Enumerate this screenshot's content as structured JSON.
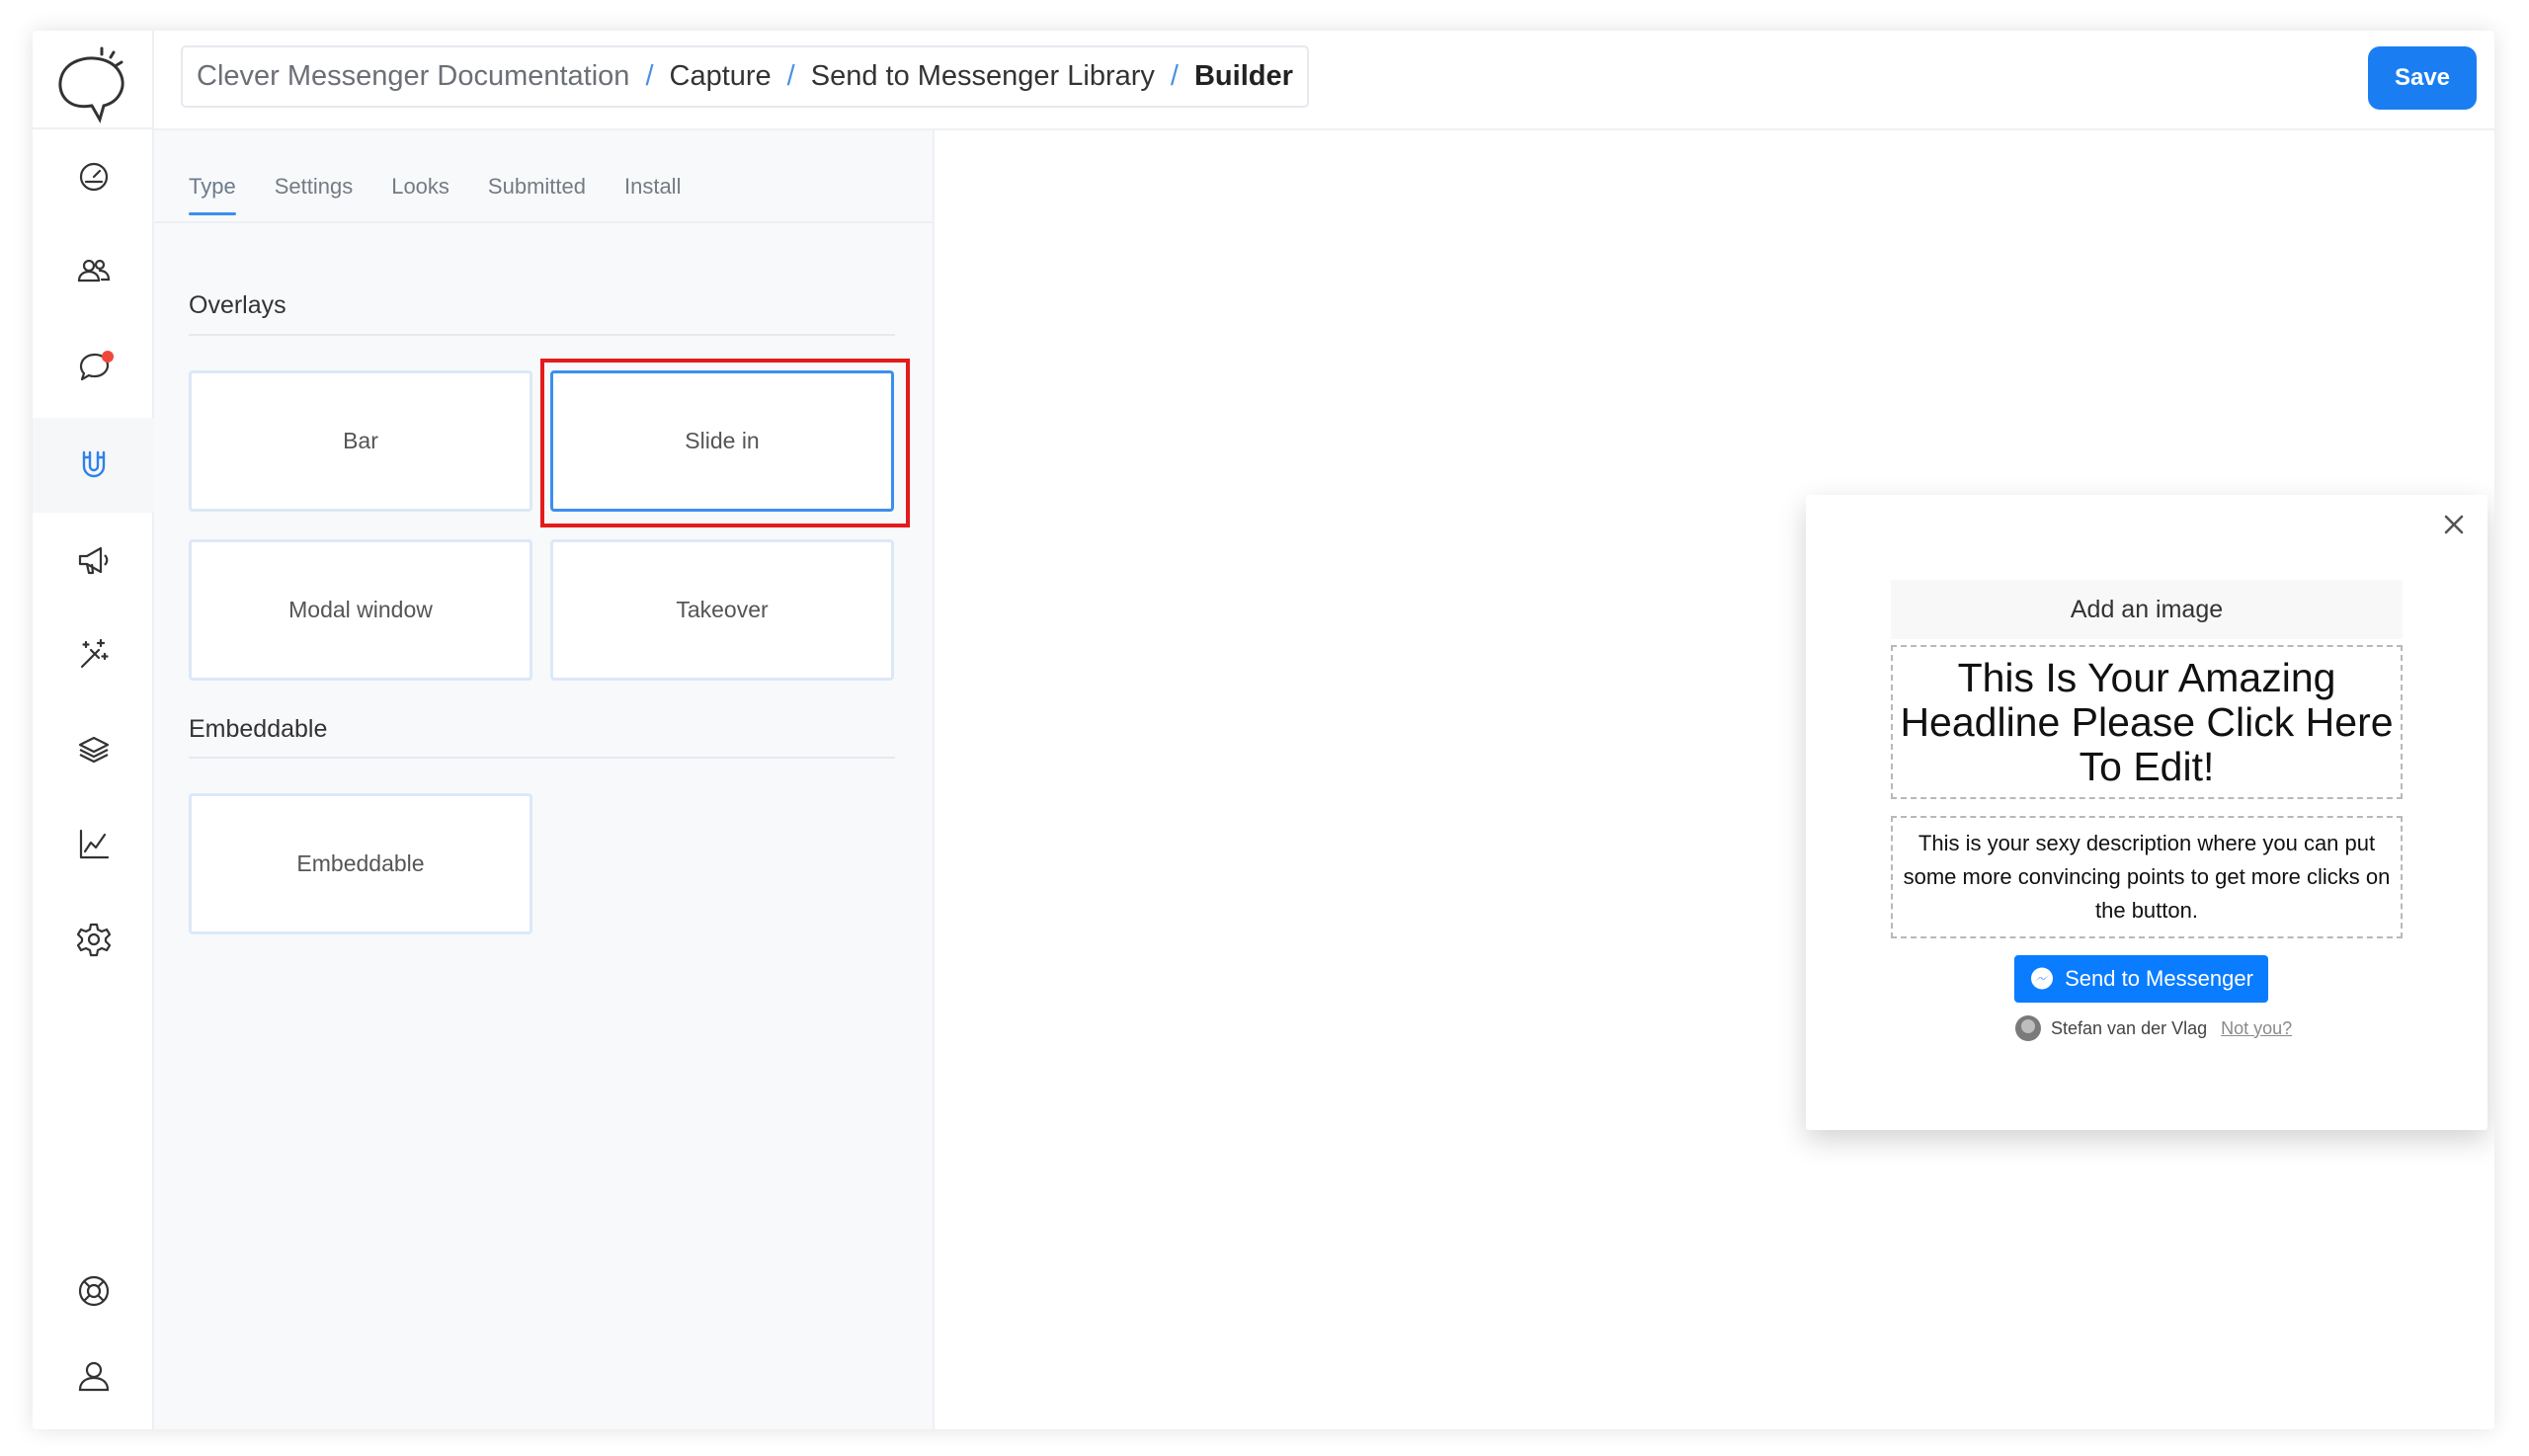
{
  "header": {
    "breadcrumb": [
      "Clever Messenger Documentation",
      "Capture",
      "Send to Messenger Library",
      "Builder"
    ],
    "separator": "/",
    "save_label": "Save"
  },
  "sidebar": {
    "items": [
      {
        "icon": "dashboard-icon",
        "active": false
      },
      {
        "icon": "users-icon",
        "active": false
      },
      {
        "icon": "chat-icon",
        "active": false,
        "badge": true
      },
      {
        "icon": "magnet-icon",
        "active": true
      },
      {
        "icon": "megaphone-icon",
        "active": false
      },
      {
        "icon": "magic-wand-icon",
        "active": false
      },
      {
        "icon": "layers-icon",
        "active": false
      },
      {
        "icon": "analytics-icon",
        "active": false
      },
      {
        "icon": "settings-icon",
        "active": false
      },
      {
        "icon": "help-lifebuoy-icon",
        "active": false
      },
      {
        "icon": "account-icon",
        "active": false
      }
    ]
  },
  "panel": {
    "tabs": [
      "Type",
      "Settings",
      "Looks",
      "Submitted",
      "Install"
    ],
    "active_tab": "Type",
    "overlays_title": "Overlays",
    "overlays": [
      "Bar",
      "Slide in",
      "Modal window",
      "Takeover"
    ],
    "selected": "Slide in",
    "embeddable_title": "Embeddable",
    "embeddables": [
      "Embeddable"
    ]
  },
  "preview": {
    "image_placeholder": "Add an image",
    "headline": "This Is Your Amazing Headline Please Click Here To Edit!",
    "description": "This is your sexy description where you can put some more convincing points to get more clicks on the button.",
    "button_label": "Send to Messenger",
    "user_name": "Stefan van der Vlag",
    "not_you": "Not you?"
  },
  "colors": {
    "accent": "#1a7ef2",
    "messenger_blue": "#0a7cff",
    "highlight_red": "#e31b1b",
    "notification_red": "#f0473b"
  }
}
